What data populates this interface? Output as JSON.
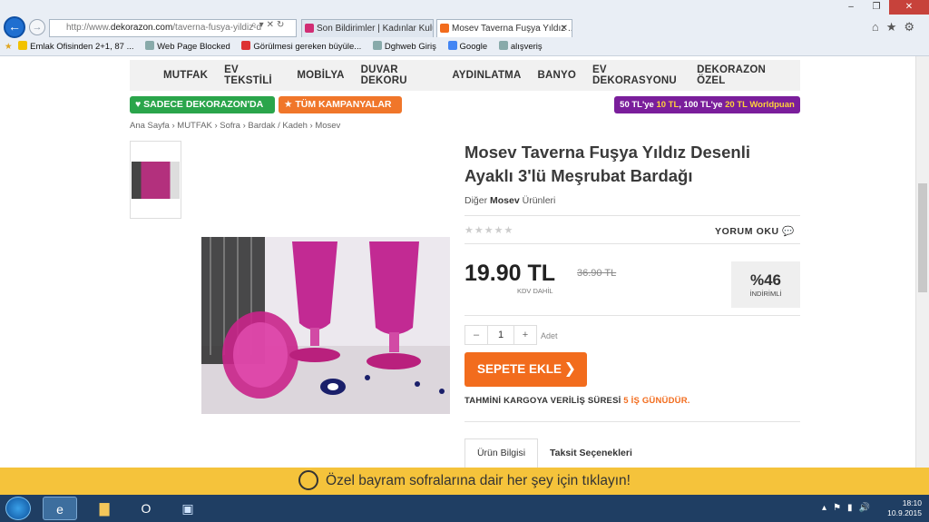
{
  "browser": {
    "address": "http://www.dekorazon.com/taverna-fusya-yildiz-d",
    "address_prefix": "http://www.",
    "address_domain": "dekorazon.com",
    "address_path": "/taverna-fusya-yildiz-d",
    "tabs": [
      {
        "label": "Son Bildirimler | Kadınlar Kulübü"
      },
      {
        "label": "Mosev Taverna Fuşya Yıldız ..."
      }
    ],
    "favorites": [
      "Emlak Ofisinden 2+1, 87 ...",
      "Web Page Blocked",
      "Görülmesi gereken büyüle...",
      "Dghweb Giriş",
      "Google",
      "alışveriş"
    ]
  },
  "nav": {
    "items": [
      "MUTFAK",
      "EV TEKSTİLİ",
      "MOBİLYA",
      "DUVAR DEKORU",
      "AYDINLATMA",
      "BANYO",
      "EV DEKORASYONU",
      "DEKORAZON ÖZEL"
    ]
  },
  "badges": {
    "sadece": "SADECE DEKORAZON'DA",
    "kampanya": "TÜM KAMPANYALAR",
    "puan_a": "50 TL'ye ",
    "puan_b": "10 TL",
    "puan_c": ", 100 TL'ye ",
    "puan_d": "20 TL Worldpuan"
  },
  "breadcrumb": "Ana Sayfa › MUTFAK › Sofra › Bardak / Kadeh › Mosev",
  "product": {
    "title_line1": "Mosev Taverna Fuşya Yıldız Desenli",
    "title_line2": "Ayaklı 3'lü Meşrubat Bardağı",
    "other_pre": "Diğer ",
    "other_brand": "Mosev",
    "other_post": " Ürünleri",
    "yorum": "YORUM OKU",
    "price": "19.90 TL",
    "kdv": "KDV DAHİL",
    "old_price": "36.90 TL",
    "discount": "%46",
    "discount_label": "İNDİRİMLİ",
    "qty_minus": "–",
    "qty_value": "1",
    "qty_plus": "+",
    "unit": "Adet",
    "cart": "SEPETE EKLE",
    "ship_pre": "TAHMİNİ KARGOYA VERİLİŞ SÜRESİ ",
    "ship_val": "5 İŞ GÜNÜDÜR.",
    "tab_info": "Ürün Bilgisi",
    "tab_taksit": "Taksit Seçenekleri"
  },
  "banner": "Özel bayram sofralarına dair her şey için tıklayın!",
  "taskbar": {
    "time": "18:10",
    "date": "10.9.2015"
  },
  "colors": {
    "green": "#2aa54b",
    "orange": "#f26c1d",
    "purple": "#7a1e9b",
    "banner": "#f5c33b"
  }
}
